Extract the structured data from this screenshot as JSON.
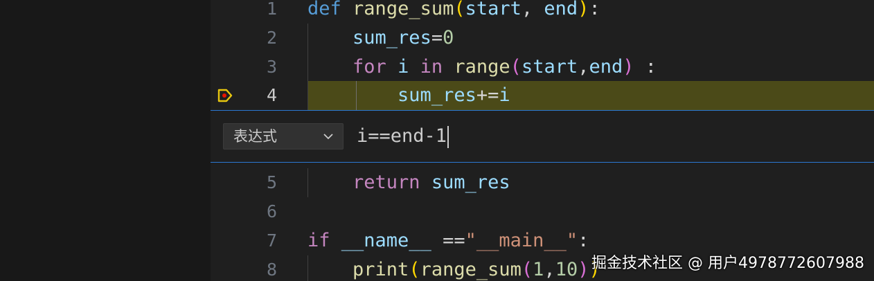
{
  "editor": {
    "lines_top": [
      {
        "number": "1",
        "tokens": [
          {
            "t": "def",
            "c": "kw"
          },
          {
            "t": " ",
            "c": "plain"
          },
          {
            "t": "range_sum",
            "c": "fn"
          },
          {
            "t": "(",
            "c": "p1"
          },
          {
            "t": "start",
            "c": "param"
          },
          {
            "t": ", ",
            "c": "plain"
          },
          {
            "t": "end",
            "c": "param"
          },
          {
            "t": ")",
            "c": "p1"
          },
          {
            "t": ":",
            "c": "plain"
          }
        ]
      },
      {
        "number": "2",
        "tokens": [
          {
            "t": "    ",
            "c": "plain"
          },
          {
            "t": "sum_res",
            "c": "var"
          },
          {
            "t": "=",
            "c": "plain"
          },
          {
            "t": "0",
            "c": "num"
          }
        ]
      },
      {
        "number": "3",
        "tokens": [
          {
            "t": "    ",
            "c": "plain"
          },
          {
            "t": "for",
            "c": "ctrl"
          },
          {
            "t": " ",
            "c": "plain"
          },
          {
            "t": "i",
            "c": "var"
          },
          {
            "t": " ",
            "c": "plain"
          },
          {
            "t": "in",
            "c": "ctrl"
          },
          {
            "t": " ",
            "c": "plain"
          },
          {
            "t": "range",
            "c": "fn"
          },
          {
            "t": "(",
            "c": "p2"
          },
          {
            "t": "start",
            "c": "var"
          },
          {
            "t": ",",
            "c": "plain"
          },
          {
            "t": "end",
            "c": "var"
          },
          {
            "t": ")",
            "c": "p2"
          },
          {
            "t": " :",
            "c": "plain"
          }
        ]
      },
      {
        "number": "4",
        "tokens": [
          {
            "t": "        ",
            "c": "plain"
          },
          {
            "t": "sum_res",
            "c": "var"
          },
          {
            "t": "+=",
            "c": "plain"
          },
          {
            "t": "i",
            "c": "var"
          }
        ]
      }
    ],
    "lines_bottom": [
      {
        "number": "5",
        "tokens": [
          {
            "t": "    ",
            "c": "plain"
          },
          {
            "t": "return",
            "c": "ctrl"
          },
          {
            "t": " ",
            "c": "plain"
          },
          {
            "t": "sum_res",
            "c": "var"
          }
        ]
      },
      {
        "number": "6",
        "tokens": []
      },
      {
        "number": "7",
        "tokens": [
          {
            "t": "if",
            "c": "ctrl"
          },
          {
            "t": " ",
            "c": "plain"
          },
          {
            "t": "__name__",
            "c": "var"
          },
          {
            "t": " ==",
            "c": "plain"
          },
          {
            "t": "\"__main__\"",
            "c": "str"
          },
          {
            "t": ":",
            "c": "plain"
          }
        ]
      },
      {
        "number": "8",
        "tokens": [
          {
            "t": "    ",
            "c": "plain"
          },
          {
            "t": "print",
            "c": "fn"
          },
          {
            "t": "(",
            "c": "p1"
          },
          {
            "t": "range_sum",
            "c": "fn"
          },
          {
            "t": "(",
            "c": "p2"
          },
          {
            "t": "1",
            "c": "num"
          },
          {
            "t": ",",
            "c": "plain"
          },
          {
            "t": "10",
            "c": "num"
          },
          {
            "t": ")",
            "c": "p2"
          },
          {
            "t": ")",
            "c": "p1"
          }
        ]
      }
    ],
    "breakpoint_line": "4",
    "breakpoint_icon": "conditional-breakpoint-icon"
  },
  "breakpoint_widget": {
    "type_select": {
      "value": "表达式",
      "icon": "chevron-down-icon"
    },
    "condition": "i==end-1"
  },
  "watermark": "掘金技术社区 @ 用户4978772607988",
  "colors": {
    "accent_border": "#2b79d4",
    "breakpoint_highlight": "#4b4a18",
    "breakpoint_icon": "#e8c70f"
  }
}
